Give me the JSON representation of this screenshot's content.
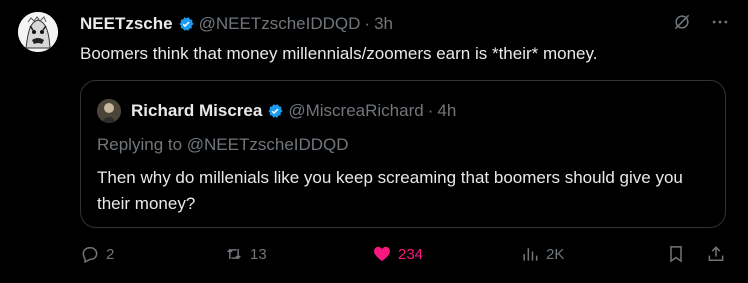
{
  "tweet": {
    "author_name": "NEETzsche",
    "author_handle": "@NEETzscheIDDQD",
    "time": "3h",
    "text": "Boomers think that money millennials/zoomers earn is *their* money."
  },
  "quoted": {
    "author_name": "Richard Miscrea",
    "author_handle": "@MiscreaRichard",
    "time": "4h",
    "replying_to": "Replying to @NEETzscheIDDQD",
    "text": "Then why do millenials like you keep screaming that boomers should give you their money?"
  },
  "actions": {
    "replies": "2",
    "reposts": "13",
    "likes": "234",
    "views": "2K"
  },
  "colors": {
    "accent": "#1d9bf0",
    "like": "#f91880",
    "muted": "#71767b"
  },
  "icons": {
    "verified": "verified-badge-icon",
    "grok": "grok-icon",
    "more": "more-icon",
    "reply": "reply-icon",
    "repost": "repost-icon",
    "like": "heart-icon",
    "views": "views-icon",
    "bookmark": "bookmark-icon",
    "share": "share-icon"
  }
}
